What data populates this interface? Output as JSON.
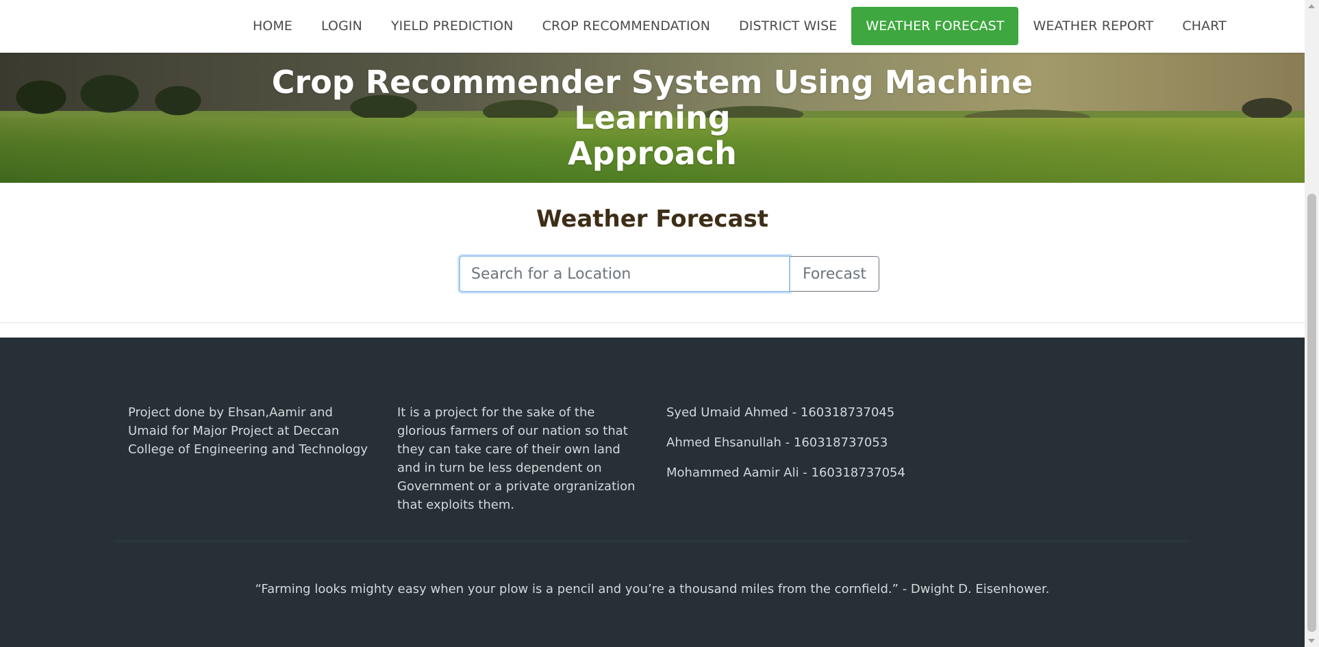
{
  "nav": {
    "items": [
      {
        "label": "HOME"
      },
      {
        "label": "LOGIN"
      },
      {
        "label": "YIELD PREDICTION"
      },
      {
        "label": "CROP RECOMMENDATION"
      },
      {
        "label": "DISTRICT WISE"
      },
      {
        "label": "WEATHER FORECAST"
      },
      {
        "label": "WEATHER REPORT"
      },
      {
        "label": "CHART"
      }
    ],
    "active_item": "WEATHER FORECAST"
  },
  "hero": {
    "title_line1": "Crop Recommender System Using Machine Learning",
    "title_line2": "Approach"
  },
  "weather": {
    "title": "Weather Forecast",
    "search_placeholder": "Search for a Location",
    "search_value": "",
    "button_label": "Forecast"
  },
  "footer": {
    "col1_text": "Project done by Ehsan,Aamir and Umaid for Major Project at Deccan College of Engineering and Technology",
    "col2_text": "It is a project for the sake of the glorious farmers of our nation so that they can take care of their own land and in turn be less dependent on Government or a private orgranization that exploits them.",
    "contacts": [
      "Syed Umaid Ahmed - 160318737045",
      "Ahmed Ehsanullah - 160318737053",
      "Mohammed Aamir Ali - 160318737054"
    ],
    "quote": "“Farming looks mighty easy when your plow is a pencil and you’re a thousand miles from the cornfield.” - Dwight D. Eisenhower."
  },
  "colors": {
    "accent_green": "#3ea73f",
    "footer_bg": "#263036",
    "title_brown": "#3d2e16"
  }
}
